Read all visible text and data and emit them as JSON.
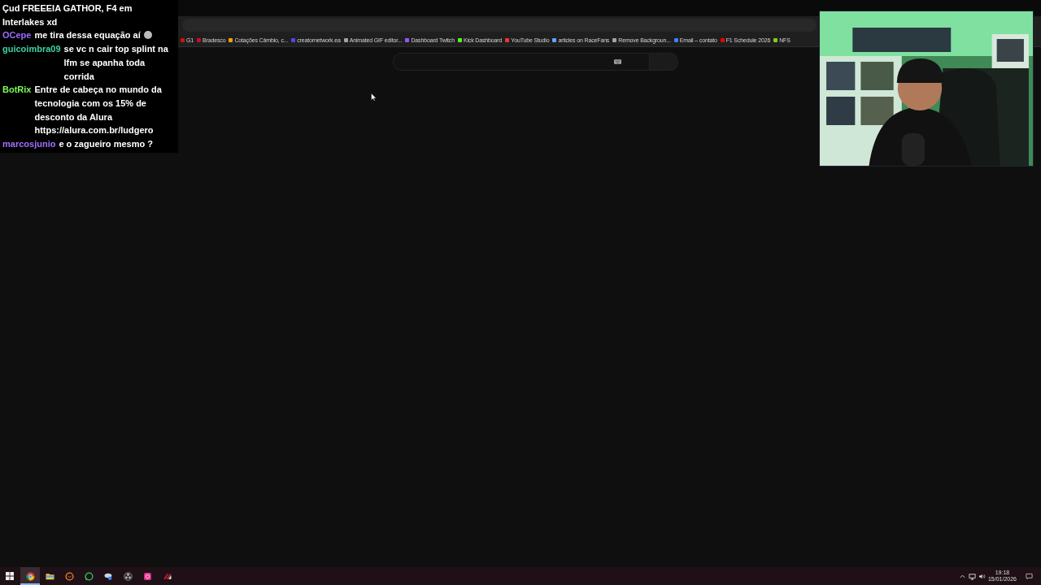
{
  "browser": {
    "bookmarks": [
      {
        "label": "G1",
        "color": "#c4170c"
      },
      {
        "label": "Bradesco",
        "color": "#cc092f"
      },
      {
        "label": "Cotações Câmbio, c...",
        "color": "#f59e0b"
      },
      {
        "label": "creatornetwork.ea",
        "color": "#4f46e5"
      },
      {
        "label": "Animated GIF editor...",
        "color": "#9ca3af"
      },
      {
        "label": "Dashboard Twitch",
        "color": "#8b5cf6"
      },
      {
        "label": "Kick Dashboard",
        "color": "#53fc18"
      },
      {
        "label": "YouTube Studio",
        "color": "#e53935"
      },
      {
        "label": "articles on RaceFans",
        "color": "#60a5fa"
      },
      {
        "label": "Remove Backgroun...",
        "color": "#9ca3af"
      },
      {
        "label": "Email – contato",
        "color": "#3b82f6"
      },
      {
        "label": "F1 Schedule 2026",
        "color": "#e10600"
      },
      {
        "label": "NFS",
        "color": "#84cc16"
      }
    ]
  },
  "chat": {
    "messages": [
      {
        "text": "Çud FREEEIA GATHOR, F4 em Interlakes xd"
      },
      {
        "user": "OCepe",
        "color": "#9b6cff",
        "text": "me tira dessa equação aí",
        "emoji": true
      },
      {
        "user": "guicoimbra09",
        "color": "#3fd1a0",
        "text": "se vc n cair top splint na lfm se apanha toda corrida"
      },
      {
        "user": "BotRix",
        "color": "#7cfc5a",
        "text": "Entre de cabeça no mundo da tecnologia com os 15% de desconto da Alura https://alura.com.br/ludgero"
      },
      {
        "user": "marcosjunio",
        "color": "#a070ff",
        "text": "e o zagueiro mesmo ?"
      }
    ]
  },
  "taskbar": {
    "apps": [
      {
        "kind": "chrome",
        "selected": true
      },
      {
        "kind": "folder",
        "selected": false
      },
      {
        "kind": "mail",
        "selected": false
      },
      {
        "kind": "whatsapp",
        "selected": false
      },
      {
        "kind": "tool",
        "selected": false
      },
      {
        "kind": "obs",
        "selected": false
      },
      {
        "kind": "pink",
        "selected": false
      },
      {
        "kind": "red",
        "selected": false
      }
    ],
    "time": "19:18",
    "date": "15/01/2026"
  }
}
